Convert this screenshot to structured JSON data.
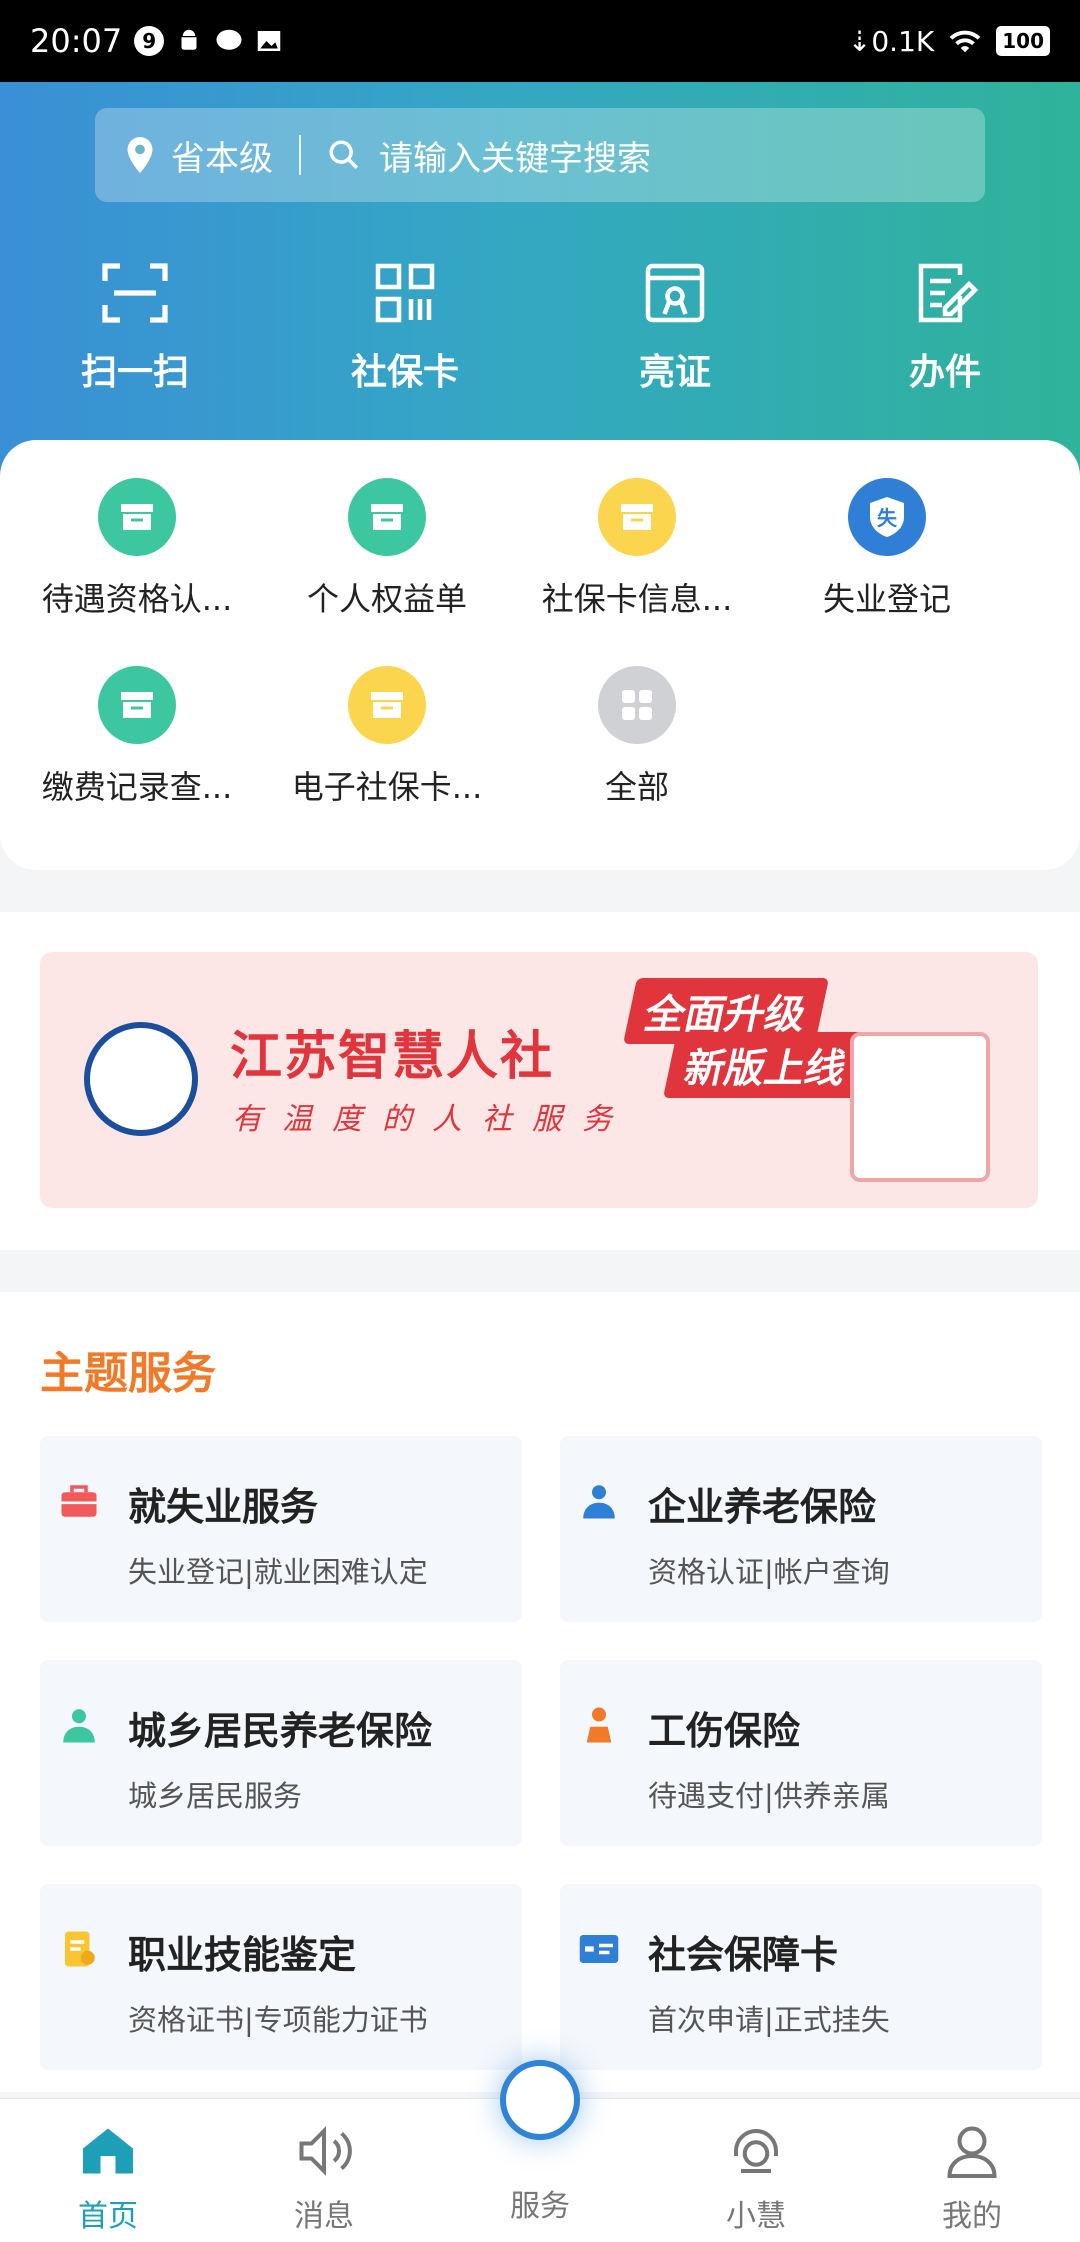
{
  "status": {
    "time": "20:07",
    "badge": "9",
    "speed": "0.1K",
    "battery": "100"
  },
  "header": {
    "region": "省本级",
    "search_placeholder": "请输入关键字搜索",
    "quick": [
      {
        "label": "扫一扫",
        "icon": "scan-icon"
      },
      {
        "label": "社保卡",
        "icon": "qrcode-icon"
      },
      {
        "label": "亮证",
        "icon": "certificate-icon"
      },
      {
        "label": "办件",
        "icon": "edit-doc-icon"
      }
    ]
  },
  "services": [
    {
      "label": "待遇资格认...",
      "color": "#3cc7a0",
      "icon": "box-icon"
    },
    {
      "label": "个人权益单",
      "color": "#3cc7a0",
      "icon": "box-icon"
    },
    {
      "label": "社保卡信息...",
      "color": "#fbd54e",
      "icon": "box-icon"
    },
    {
      "label": "失业登记",
      "color": "#2f7fd6",
      "icon": "shield-icon",
      "glyph": "失"
    },
    {
      "label": "缴费记录查...",
      "color": "#3cc7a0",
      "icon": "box-icon"
    },
    {
      "label": "电子社保卡...",
      "color": "#fbd54e",
      "icon": "box-icon"
    },
    {
      "label": "全部",
      "color": "#cfd1d4",
      "icon": "grid-icon"
    }
  ],
  "banner": {
    "title": "江苏智慧人社",
    "subtitle": "有温度的人社服务",
    "badge1": "全面升级",
    "badge2": "新版上线"
  },
  "theme": {
    "title": "主题服务",
    "tiles": [
      {
        "title": "就失业服务",
        "sub": "失业登记|就业困难认定",
        "icon": "briefcase-icon"
      },
      {
        "title": "企业养老保险",
        "sub": "资格认证|帐户查询",
        "icon": "worker-icon"
      },
      {
        "title": "城乡居民养老保险",
        "sub": "城乡居民服务",
        "icon": "resident-icon"
      },
      {
        "title": "工伤保险",
        "sub": "待遇支付|供养亲属",
        "icon": "injury-icon"
      },
      {
        "title": "职业技能鉴定",
        "sub": "资格证书|专项能力证书",
        "icon": "skill-cert-icon"
      },
      {
        "title": "社会保障卡",
        "sub": "首次申请|正式挂失",
        "icon": "si-card-icon"
      }
    ]
  },
  "tabs": [
    {
      "label": "首页",
      "icon": "home-icon"
    },
    {
      "label": "消息",
      "icon": "speaker-icon"
    },
    {
      "label": "服务",
      "icon": "service-logo-icon"
    },
    {
      "label": "小慧",
      "icon": "headset-icon"
    },
    {
      "label": "我的",
      "icon": "user-icon"
    }
  ]
}
